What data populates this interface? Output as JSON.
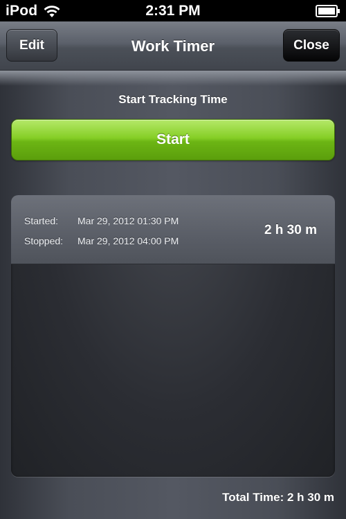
{
  "status_bar": {
    "carrier": "iPod",
    "time": "2:31 PM",
    "icons": [
      "wifi-icon",
      "battery-icon"
    ]
  },
  "nav": {
    "title": "Work Timer",
    "left_button": "Edit",
    "right_button": "Close"
  },
  "tracker": {
    "section_label": "Start Tracking Time",
    "start_button": "Start",
    "accent_color": "#7cc41a"
  },
  "entries": [
    {
      "started_label": "Started:",
      "started_value": "Mar 29, 2012 01:30 PM",
      "stopped_label": "Stopped:",
      "stopped_value": "Mar 29, 2012 04:00 PM",
      "duration": "2 h 30 m"
    }
  ],
  "footer": {
    "total": "Total Time: 2 h 30 m"
  }
}
